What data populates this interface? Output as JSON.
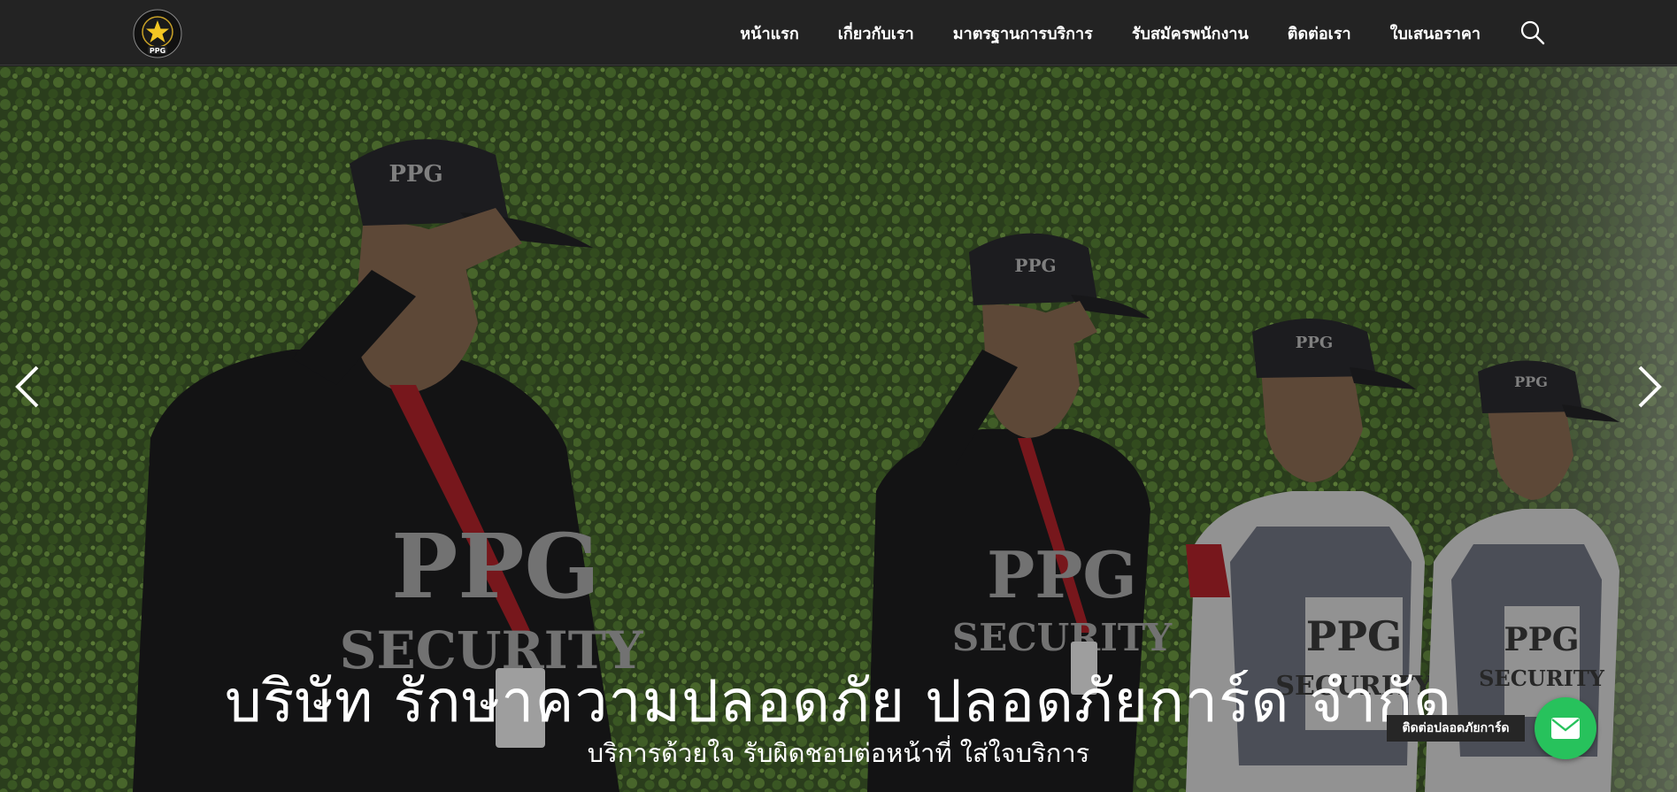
{
  "header": {
    "logo_text": "PPG",
    "nav": [
      {
        "label": "หน้าแรก"
      },
      {
        "label": "เกี่ยวกับเรา"
      },
      {
        "label": "มาตรฐานการบริการ"
      },
      {
        "label": "รับสมัครพนักงาน"
      },
      {
        "label": "ติดต่อเรา"
      },
      {
        "label": "ใบเสนอราคา"
      }
    ],
    "search_icon": "search-icon"
  },
  "hero": {
    "title": "บริษัท รักษาความปลอดภัย ปลอดภัยการ์ด จำกัด",
    "subtitle": "บริการด้วยใจ รับผิดชอบต่อหน้าที่ ใส่ใจบริการ",
    "shirt_text_line1": "PPG",
    "shirt_text_line2": "SECURITY",
    "cap_text": "PPG",
    "prev_icon": "chevron-left-icon",
    "next_icon": "chevron-right-icon"
  },
  "contact": {
    "tooltip": "ติดต่อปลอดภัยการ์ด",
    "icon": "envelope-icon",
    "color": "#27c25c"
  }
}
